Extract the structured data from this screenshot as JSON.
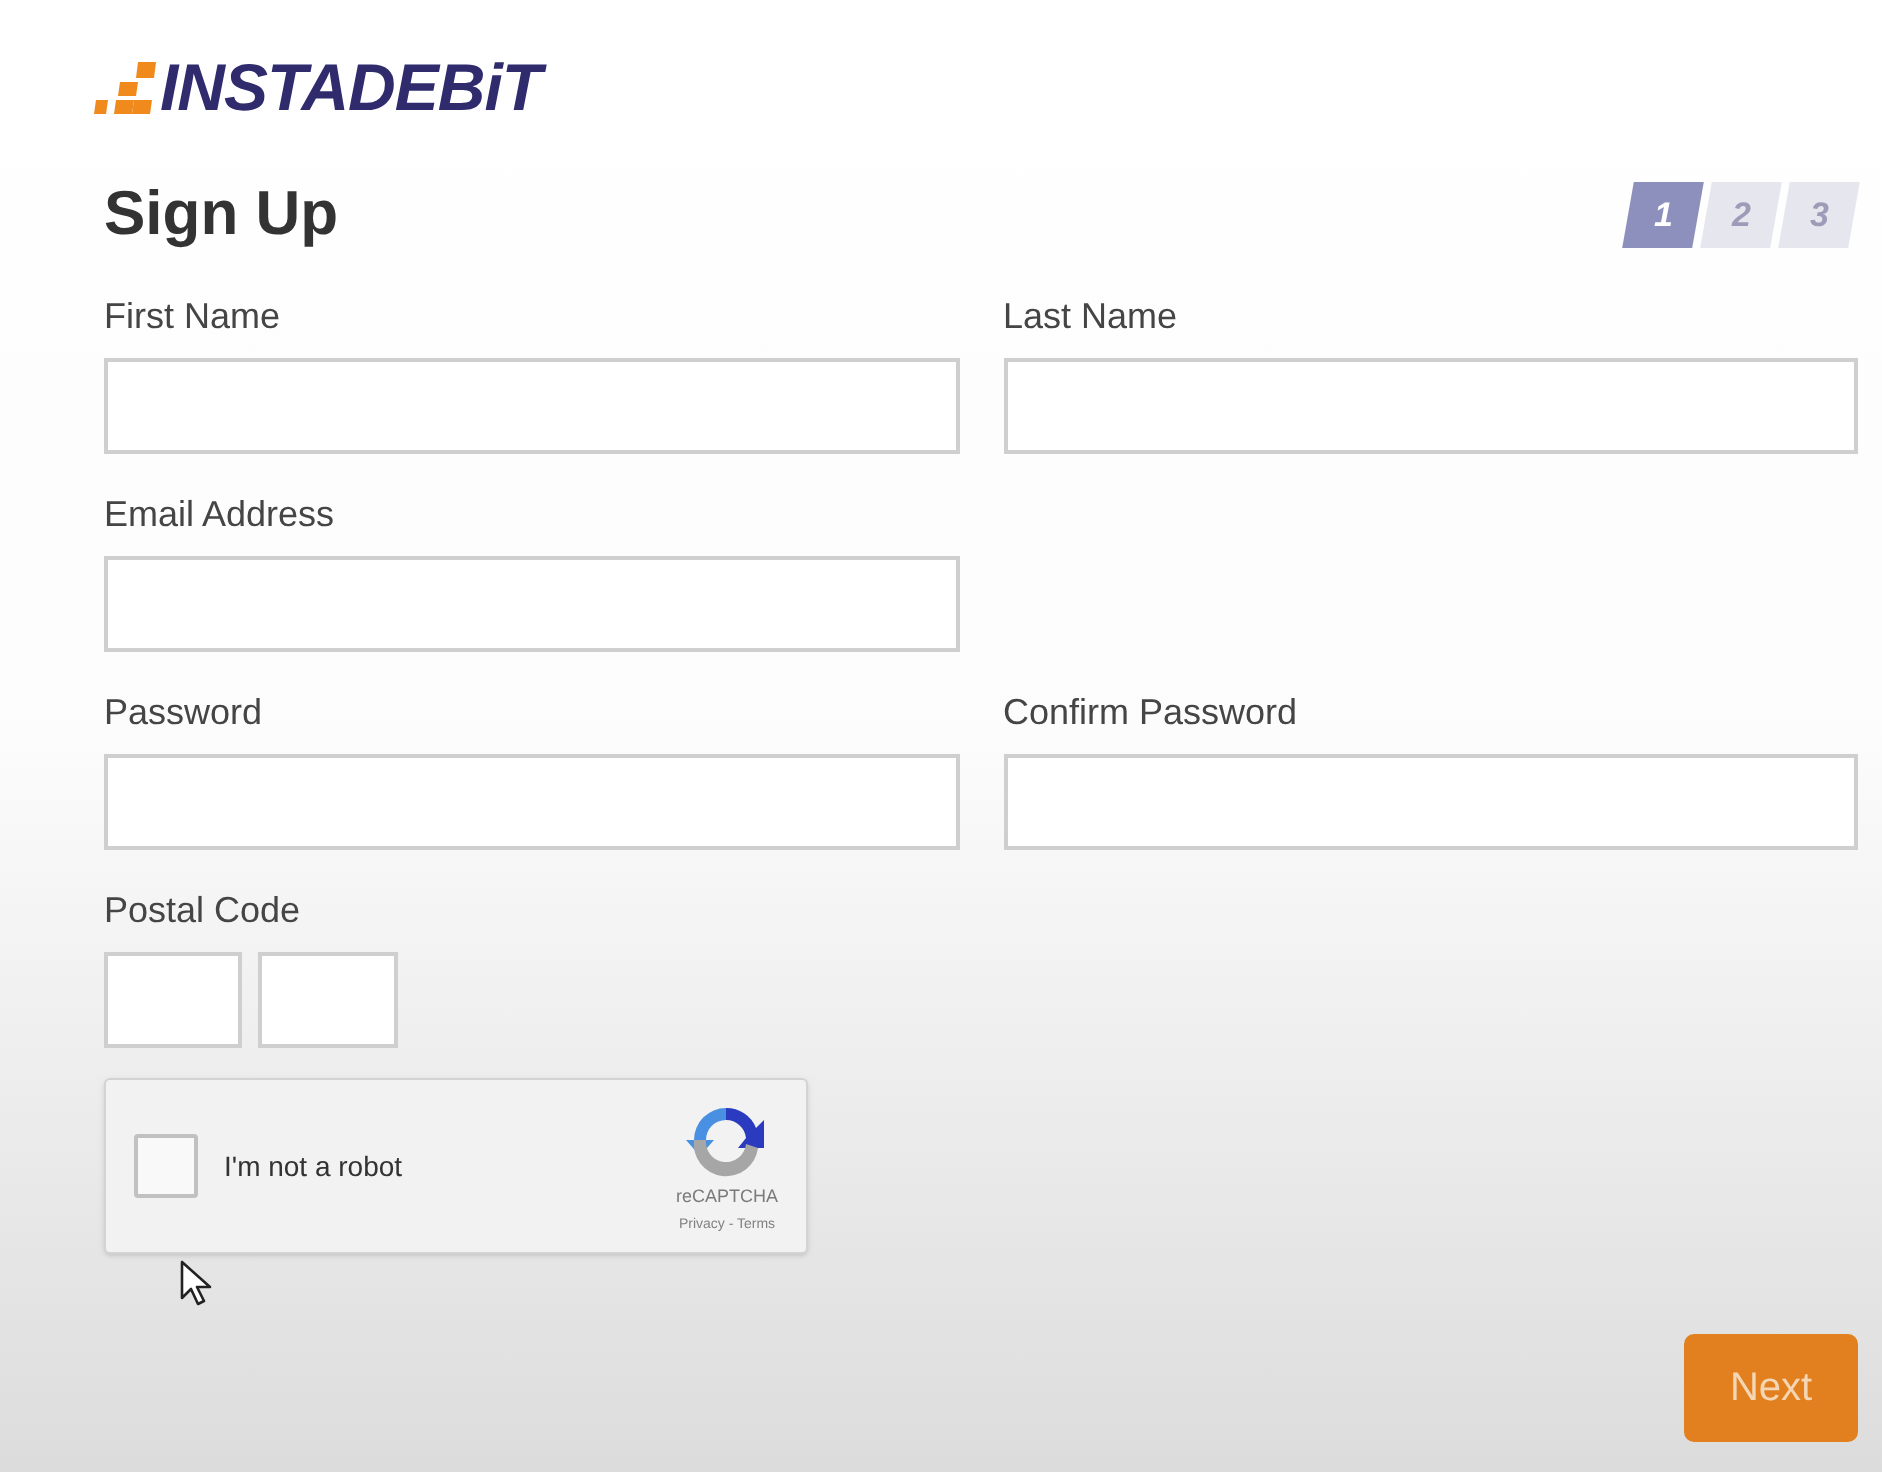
{
  "logo": {
    "text": "INSTADEBiT"
  },
  "title": "Sign Up",
  "steps": [
    {
      "label": "1",
      "selected": true
    },
    {
      "label": "2",
      "selected": false
    },
    {
      "label": "3",
      "selected": false
    }
  ],
  "rows": [
    {
      "fields": [
        {
          "label": "First Name",
          "kind": "full"
        },
        {
          "label": "Last Name",
          "kind": "full"
        }
      ]
    },
    {
      "fields": [
        {
          "label": "Email Address",
          "kind": "full"
        }
      ]
    },
    {
      "fields": [
        {
          "label": "Password",
          "kind": "full"
        },
        {
          "label": "Confirm Password",
          "kind": "full"
        }
      ]
    },
    {
      "fields": [
        {
          "label": "Postal Code",
          "kind": "split"
        }
      ]
    }
  ],
  "captcha": {
    "label": "I'm not a robot",
    "checked": false,
    "brand": "reCAPTCHA",
    "links": "Privacy - Terms"
  },
  "next_button": {
    "label": "Next"
  }
}
